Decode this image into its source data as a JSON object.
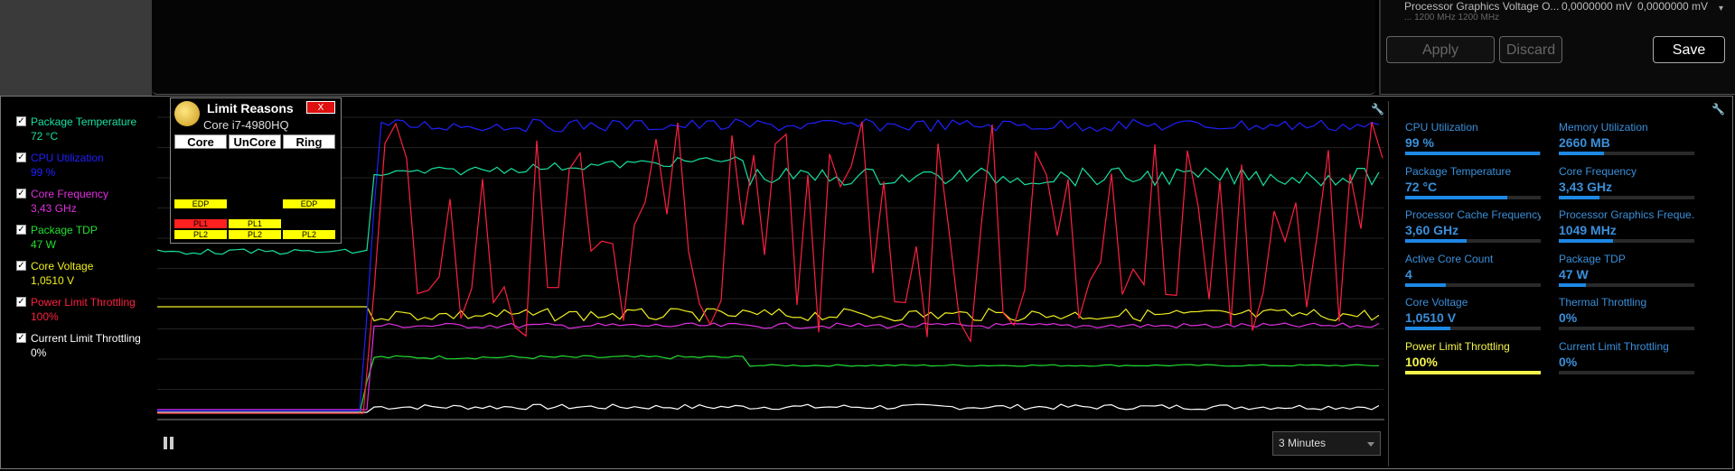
{
  "top": {
    "voltage_label": "Processor Graphics Voltage O...",
    "voltage_val1": "0,0000000 mV",
    "voltage_val2": "0,0000000 mV",
    "sub_row": "... 1200 MHz   1200 MHz",
    "apply_label": "Apply",
    "discard_label": "Discard",
    "save_label": "Save"
  },
  "legend": [
    {
      "name": "Package Temperature",
      "value": "72 °C",
      "color": "#16e0a0"
    },
    {
      "name": "CPU Utilization",
      "value": "99 %",
      "color": "#2020ff"
    },
    {
      "name": "Core Frequency",
      "value": "3,43 GHz",
      "color": "#e030e0"
    },
    {
      "name": "Package TDP",
      "value": "47 W",
      "color": "#20e030"
    },
    {
      "name": "Core Voltage",
      "value": "1,0510 V",
      "color": "#f0f020"
    },
    {
      "name": "Power Limit Throttling",
      "value": "100%",
      "color": "#ff2040"
    },
    {
      "name": "Current Limit Throttling",
      "value": "0%",
      "color": "#ffffff"
    }
  ],
  "limit_reasons": {
    "title": "Limit Reasons",
    "subtitle": "Core i7-4980HQ",
    "close_label": "X",
    "columns": [
      "Core",
      "UnCore",
      "Ring"
    ],
    "badges": {
      "edp": "EDP",
      "pl1": "PL1",
      "pl2": "PL2"
    }
  },
  "timespan": {
    "selected": "3 Minutes"
  },
  "stats": [
    {
      "label": "CPU Utilization",
      "value": "99 %",
      "fill": 0.99
    },
    {
      "label": "Memory Utilization",
      "value": "2660  MB",
      "fill": 0.33
    },
    {
      "label": "Package Temperature",
      "value": "72 °C",
      "fill": 0.75
    },
    {
      "label": "Core Frequency",
      "value": "3,43 GHz",
      "fill": 0.3
    },
    {
      "label": "Processor Cache Frequency",
      "value": "3,60 GHz",
      "fill": 0.45
    },
    {
      "label": "Processor Graphics Freque...",
      "value": "1049 MHz",
      "fill": 0.4
    },
    {
      "label": "Active Core Count",
      "value": "4",
      "fill": 0.3
    },
    {
      "label": "Package TDP",
      "value": "47 W",
      "fill": 0.2
    },
    {
      "label": "Core Voltage",
      "value": "1,0510 V",
      "fill": 0.33
    },
    {
      "label": "Thermal Throttling",
      "value": "0%",
      "fill": 0
    },
    {
      "label": "Power Limit Throttling",
      "value": "100%",
      "fill": 1.0
    },
    {
      "label": "Current Limit Throttling",
      "value": "0%",
      "fill": 0
    }
  ]
}
